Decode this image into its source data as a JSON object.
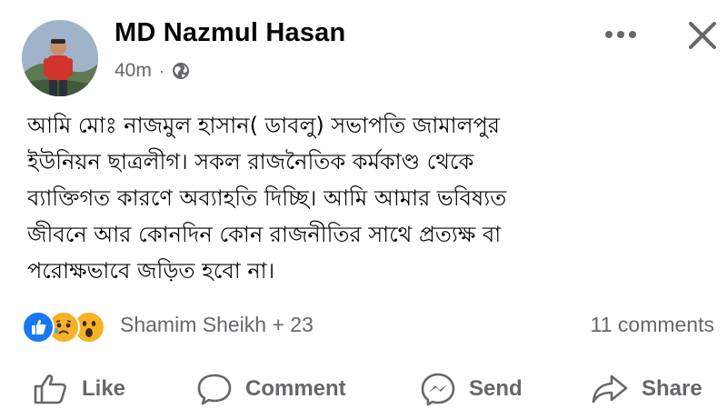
{
  "post": {
    "author": "MD Nazmul Hasan",
    "time": "40m",
    "separator": "·",
    "privacy_icon": "globe-icon",
    "more_icon": "more-dots-icon",
    "close_icon": "close-icon",
    "body_lines": [
      "আমি মোঃ নাজমুল হাসান( ডাবলু) সভাপতি জামালপুর",
      "ইউনিয়ন ছাত্রলীগ। সকল রাজনৈতিক কর্মকাণ্ড থেকে",
      "ব্যাক্তিগত কারণে  অব্যাহতি দিচ্ছি। আমি আমার ভবিষ্যত",
      "জীবনে আর কোনদিন কোন রাজনীতির সাথে প্রত্যক্ষ বা",
      "পরোক্ষভাবে জড়িত হবো না।"
    ]
  },
  "reactions": {
    "icons": [
      "like-reaction-icon",
      "sad-reaction-icon",
      "wow-reaction-icon"
    ],
    "summary": "Shamim Sheikh + 23",
    "comments": "11 comments"
  },
  "actions": {
    "like": "Like",
    "comment": "Comment",
    "send": "Send",
    "share": "Share"
  },
  "colors": {
    "text": "#050505",
    "secondary": "#65676b",
    "like_blue": "#1877f2",
    "emoji_yellow": "#f7b125"
  }
}
